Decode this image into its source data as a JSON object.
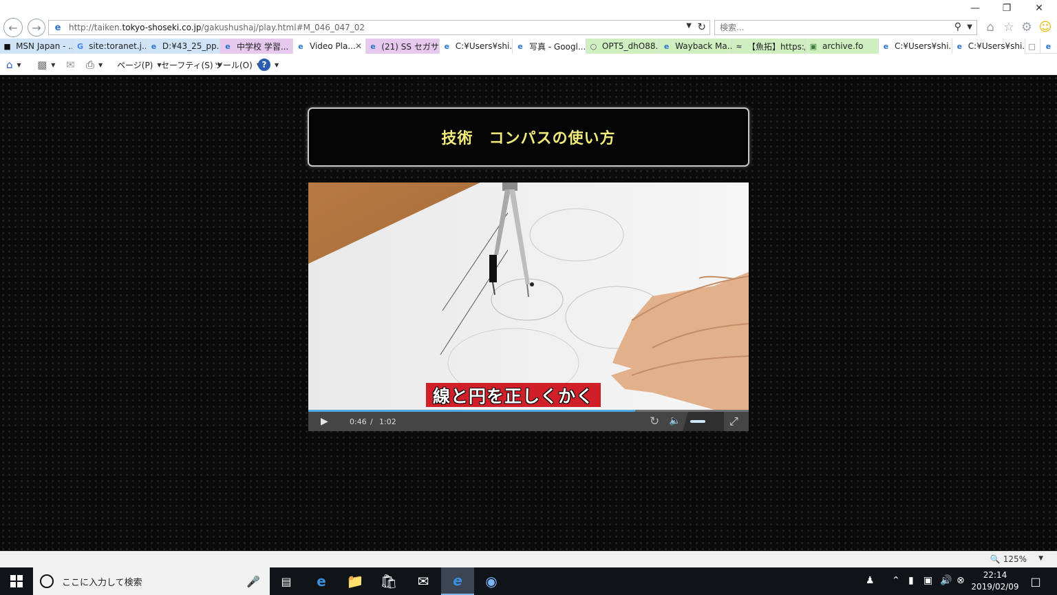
{
  "browser": {
    "url_prefix": "http://taiken.",
    "url_domain": "tokyo-shoseki.co.jp",
    "url_path": "/gakushushaj/play.html#M_046_047_02",
    "search_placeholder": "検索...",
    "tabs": [
      {
        "label": "MSN Japan - ...",
        "icon": "msn-icon"
      },
      {
        "label": "site:toranet.j...",
        "icon": "google-icon"
      },
      {
        "label": "D:¥43_25_pp...",
        "icon": "ie-icon"
      },
      {
        "label": "中学校 学習...",
        "icon": "ie-icon"
      },
      {
        "label": "Video Pla...",
        "icon": "ie-icon"
      },
      {
        "label": "(21) SS セガサ...",
        "icon": "ie-icon"
      },
      {
        "label": "C:¥Users¥shi...",
        "icon": "ie-icon"
      },
      {
        "label": "写真 - Googl...",
        "icon": "ie-icon"
      },
      {
        "label": "OPT5_dhO88...",
        "icon": "circle-icon"
      },
      {
        "label": "Wayback Ma...",
        "icon": "ie-icon"
      },
      {
        "label": "【魚拓】https:/...",
        "icon": "gyotaku-icon"
      },
      {
        "label": "archive.fo",
        "icon": "archive-icon"
      },
      {
        "label": "C:¥Users¥shi...",
        "icon": "ie-icon"
      },
      {
        "label": "C:¥Users¥shi...",
        "icon": "ie-icon"
      }
    ],
    "tab_colors": {
      "active": "#ffffff",
      "blue": "#cfe4f7",
      "purple": "#e7c9ef",
      "green": "#cfefc1"
    },
    "commands": {
      "page": "ページ(P)",
      "safety": "セーフティ(S)",
      "tools": "ツール(O)"
    },
    "zoom": "125%"
  },
  "page": {
    "title": "技術　コンパスの使い方",
    "title_color": "#f3ec7a",
    "video": {
      "caption": "線と円を正しくかく",
      "time_current": "0:46",
      "time_sep": "/",
      "time_total": "1:02",
      "progress": 0.742,
      "volume": 0.5
    }
  },
  "taskbar": {
    "search_text": "ここに入力して検索",
    "time": "22:14",
    "date": "2019/02/09"
  }
}
